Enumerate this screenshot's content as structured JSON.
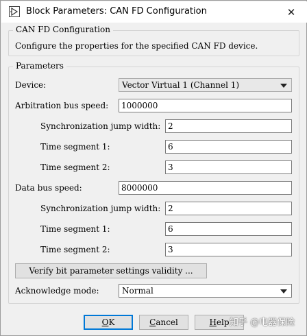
{
  "window": {
    "title": "Block Parameters: CAN FD Configuration",
    "close_glyph": "✕"
  },
  "description_group": {
    "title": "CAN FD Configuration",
    "text": "Configure the properties for the specified CAN FD device."
  },
  "parameters": {
    "title": "Parameters",
    "device": {
      "label": "Device:",
      "value": "Vector Virtual 1 (Channel 1)"
    },
    "arbitration": {
      "label": "Arbitration bus speed:",
      "value": "1000000",
      "sjw_label": "Synchronization jump width:",
      "sjw_value": "2",
      "ts1_label": "Time segment 1:",
      "ts1_value": "6",
      "ts2_label": "Time segment 2:",
      "ts2_value": "3"
    },
    "data": {
      "label": "Data bus speed:",
      "value": "8000000",
      "sjw_label": "Synchronization jump width:",
      "sjw_value": "2",
      "ts1_label": "Time segment 1:",
      "ts1_value": "6",
      "ts2_label": "Time segment 2:",
      "ts2_value": "3"
    },
    "verify_button": "Verify bit parameter settings validity ...",
    "ack": {
      "label": "Acknowledge mode:",
      "value": "Normal"
    }
  },
  "buttons": {
    "ok": {
      "mnemonic": "O",
      "rest": "K"
    },
    "cancel": {
      "mnemonic": "C",
      "rest": "ancel"
    },
    "help": {
      "mnemonic": "H",
      "rest": "elp"
    }
  },
  "watermark": "知乎 @电器保险",
  "colors": {
    "accent": "#0078d7",
    "background": "#f0f0f0",
    "border": "#d4d4d4"
  },
  "icons": {
    "app": "block-parameters-icon",
    "close": "close-icon",
    "dropdown": "chevron-down-icon"
  }
}
